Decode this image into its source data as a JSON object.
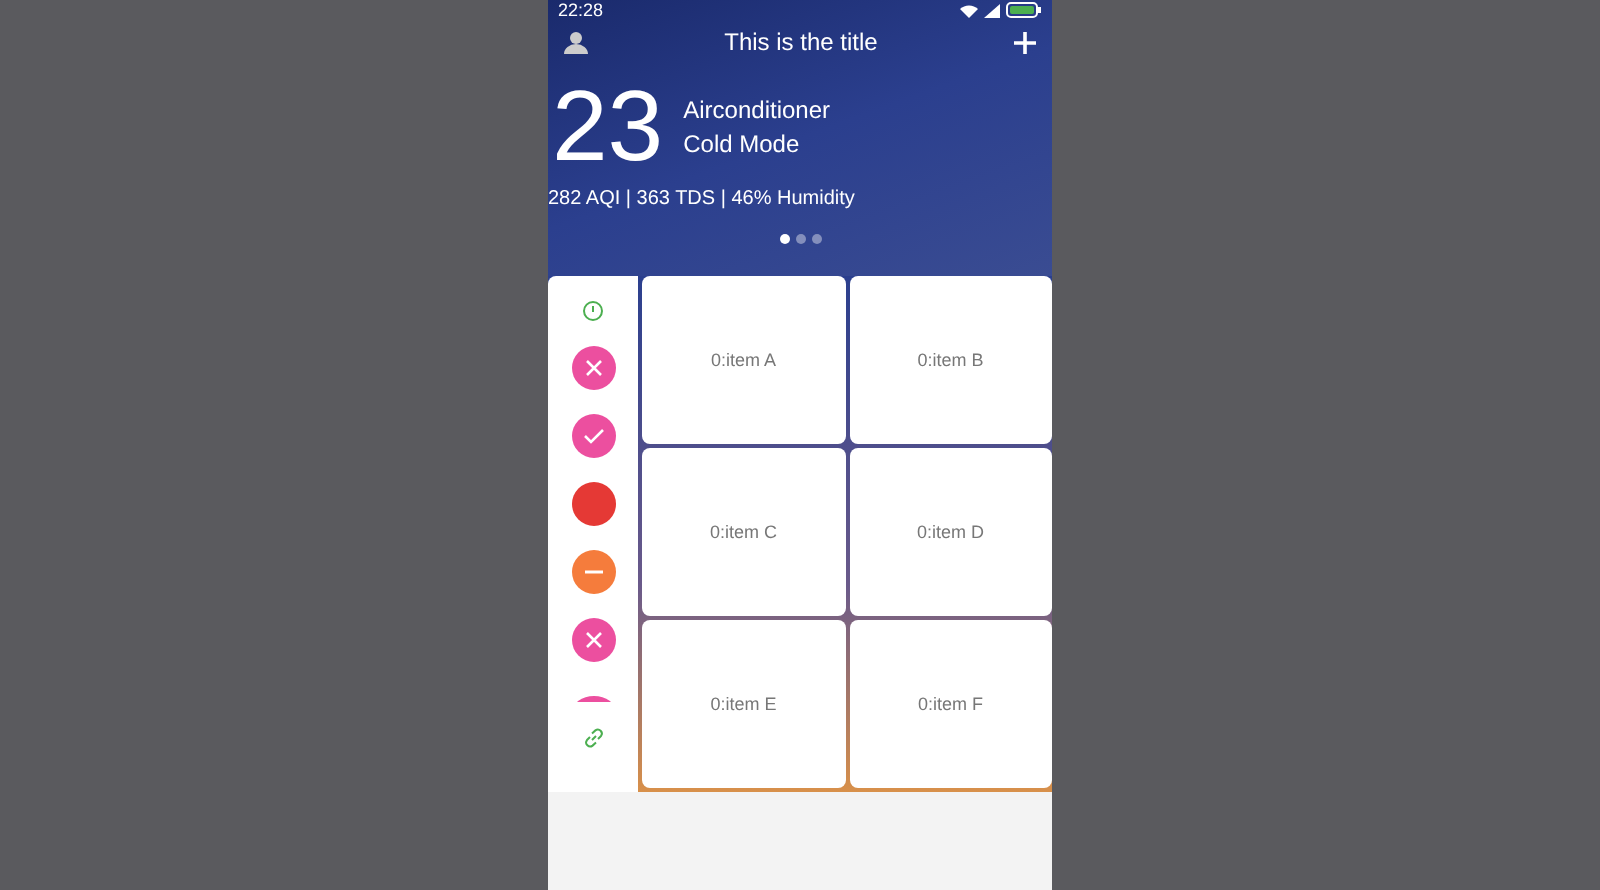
{
  "status_bar": {
    "time": "22:28"
  },
  "header": {
    "title": "This is the title",
    "temperature": "23",
    "device": "Airconditioner",
    "mode": "Cold Mode",
    "stats": "282 AQI | 363 TDS | 46% Humidity"
  },
  "pager": [
    {
      "selected": true
    },
    {
      "selected": false
    },
    {
      "selected": false
    }
  ],
  "side_buttons": [
    {
      "kind": "clock",
      "color": "#4caf50"
    },
    {
      "kind": "close",
      "color": "#ec4f9f"
    },
    {
      "kind": "check",
      "color": "#ec4f9f"
    },
    {
      "kind": "plain",
      "color": "#e53935"
    },
    {
      "kind": "minus",
      "color": "#f57c3c"
    },
    {
      "kind": "close",
      "color": "#ec4f9f"
    },
    {
      "kind": "partial",
      "color": "#ec4f9f"
    },
    {
      "kind": "link",
      "color": "#4caf50"
    }
  ],
  "grid_items": [
    {
      "label": "0:item A"
    },
    {
      "label": "0:item B"
    },
    {
      "label": "0:item C"
    },
    {
      "label": "0:item D"
    },
    {
      "label": "0:item E"
    },
    {
      "label": "0:item F"
    }
  ]
}
